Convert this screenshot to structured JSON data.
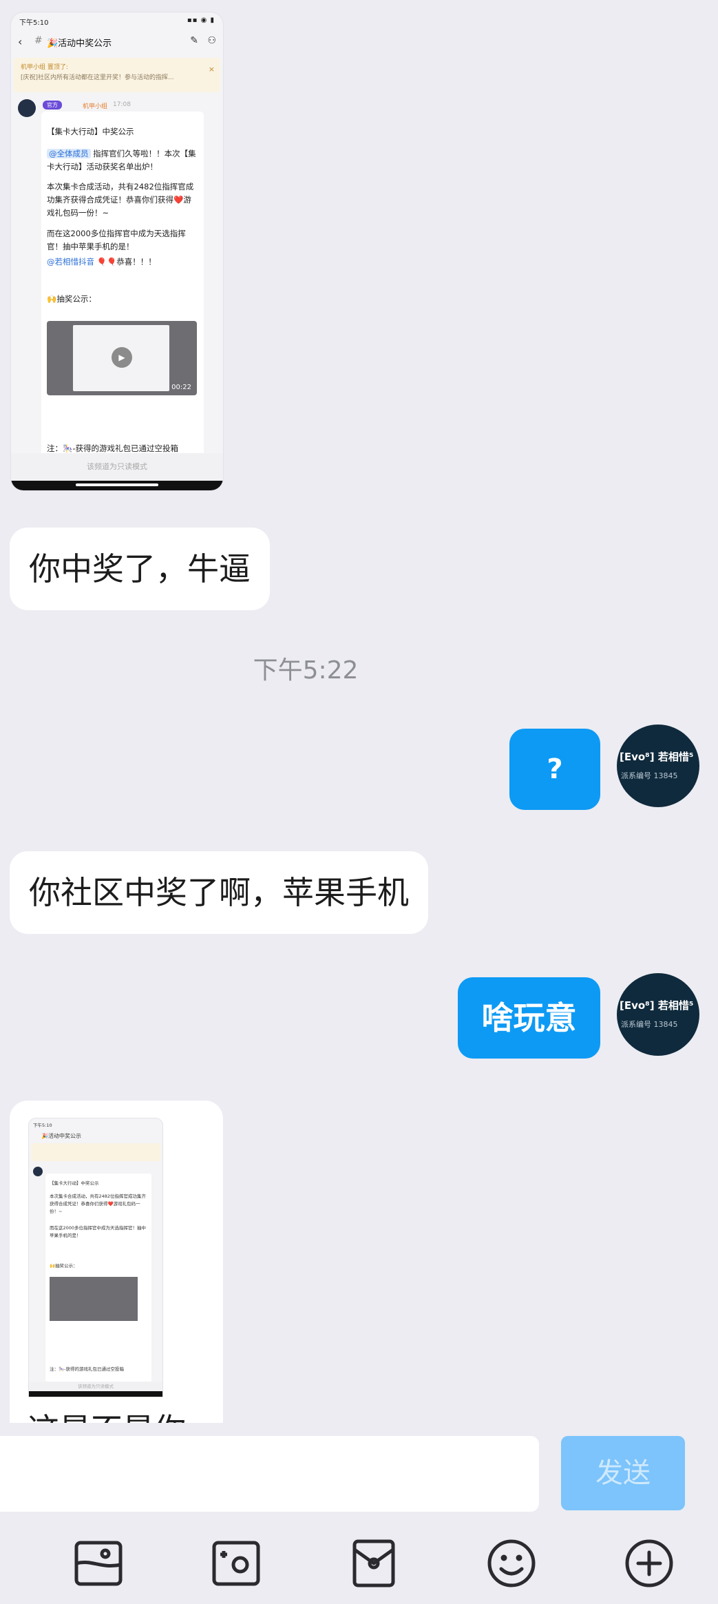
{
  "embedded_screenshot": {
    "status_time": "下午5:10",
    "status_right": "▪▪ ◉ ▮",
    "channel_title": "🎉活动中奖公示",
    "notice_line1": "机甲小组 置顶了:",
    "notice_line2": "[庆祝]社区内所有活动都在这里开奖！参与活动的指挥...",
    "badge": "官方",
    "sender": "机甲小组",
    "time": "17:08",
    "card_title": "【集卡大行动】中奖公示",
    "mention_all": "@全体成员",
    "line1": " 指挥官们久等啦！！本次【集卡大行动】活动获奖名单出炉！",
    "line2": "本次集卡合成活动，共有2482位指挥官成功集齐获得合成凭证！恭喜你们获得❤️游戏礼包码一份！~",
    "line3": " 而在这2000多位指挥官中成为天选指挥官！抽中苹果手机的是！",
    "mention_user": "@若相惜抖音",
    "line4": " 🎈🎈恭喜！！！",
    "draw_notice": "🙌抽奖公示：",
    "video_duration": "00:22",
    "note": "注：🎠-获得的游戏礼包已通过空投箱",
    "readonly": "该频道为只读模式"
  },
  "messages": {
    "m1": "你中奖了，牛逼",
    "timestamp": "下午5:22",
    "m2": "?",
    "m3": "你社区中奖了啊，苹果手机",
    "m4": "啥玩意",
    "m5_partial": "这是不是你"
  },
  "avatar": {
    "name": "[Evo⁸] 若相惜⁵",
    "id": "派系编号  13845"
  },
  "composer": {
    "input_value": "",
    "send_label": "发送"
  },
  "toolbar": {
    "icons": [
      "image-icon",
      "camera-icon",
      "red-packet-icon",
      "emoji-icon",
      "plus-icon"
    ]
  },
  "colors": {
    "outgoing_bubble": "#0d9af4",
    "send_disabled": "#7cc4fb",
    "background": "#ececf2"
  }
}
